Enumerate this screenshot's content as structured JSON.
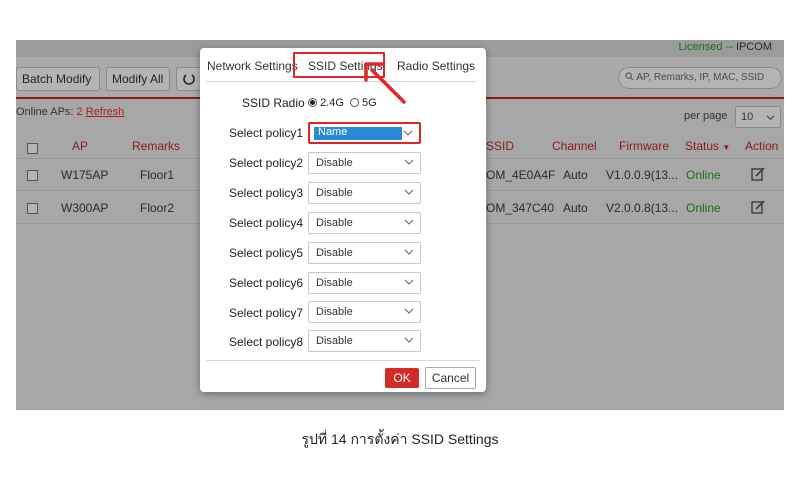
{
  "header": {
    "licensed": "Licensed --",
    "brand": "IPCOM"
  },
  "toolbar": {
    "batch_modify": "Batch Modify",
    "modify_all": "Modify All",
    "search_placeholder": "AP, Remarks, IP, MAC, SSID"
  },
  "list_info": {
    "online_label": "Online APs:",
    "online_count": "2",
    "refresh": "Refresh",
    "per_page": "per page",
    "per_page_value": "10"
  },
  "table": {
    "headers": [
      "AP",
      "Remarks",
      "SSID",
      "Channel",
      "Firmware",
      "Status",
      "Action"
    ],
    "rows": [
      {
        "ap": "W175AP",
        "remarks": "Floor1",
        "ssid": "OM_4E0A4F",
        "channel": "Auto",
        "firmware": "V1.0.0.9(13...",
        "status": "Online"
      },
      {
        "ap": "W300AP",
        "remarks": "Floor2",
        "ssid": "OM_347C40",
        "channel": "Auto",
        "firmware": "V2.0.0.8(13...",
        "status": "Online"
      }
    ]
  },
  "modal": {
    "tabs": [
      "Network Settings",
      "SSID Settings",
      "Radio Settings"
    ],
    "active_tab": "SSID Settings",
    "ssid_radio_label": "SSID Radio",
    "radio_24": "2.4G",
    "radio_5": "5G",
    "radio_selected": "2.4G",
    "policies": [
      {
        "label": "Select policy1",
        "value": "Name"
      },
      {
        "label": "Select policy2",
        "value": "Disable"
      },
      {
        "label": "Select policy3",
        "value": "Disable"
      },
      {
        "label": "Select policy4",
        "value": "Disable"
      },
      {
        "label": "Select policy5",
        "value": "Disable"
      },
      {
        "label": "Select policy6",
        "value": "Disable"
      },
      {
        "label": "Select policy7",
        "value": "Disable"
      },
      {
        "label": "Select policy8",
        "value": "Disable"
      }
    ],
    "ok": "OK",
    "cancel": "Cancel"
  },
  "caption": "รูปที่ 14 การตั้งค่า SSID Settings",
  "colors": {
    "accent_red": "#d42a2a",
    "highlight_red": "#e0262a",
    "online_green": "#1a6f1a",
    "selection_blue": "#2a8ad8"
  }
}
